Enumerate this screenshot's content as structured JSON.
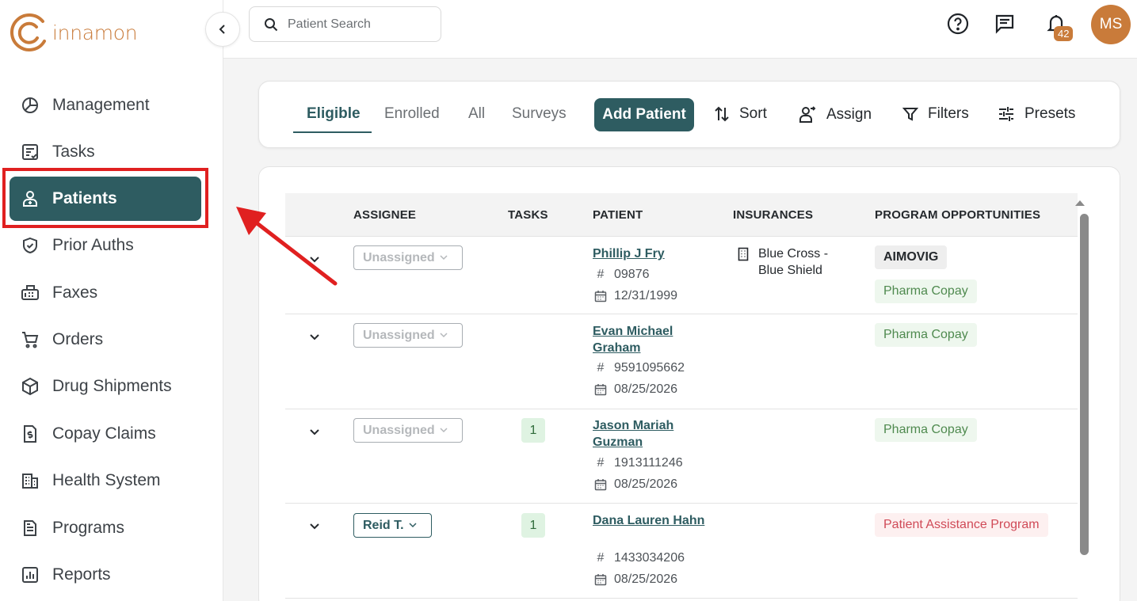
{
  "brand": {
    "name": "innamon"
  },
  "sidebar": {
    "items": [
      {
        "label": "Management",
        "icon": "management-icon"
      },
      {
        "label": "Tasks",
        "icon": "tasks-icon"
      },
      {
        "label": "Patients",
        "icon": "patients-icon",
        "active": true
      },
      {
        "label": "Prior Auths",
        "icon": "shield-icon"
      },
      {
        "label": "Faxes",
        "icon": "fax-icon"
      },
      {
        "label": "Orders",
        "icon": "cart-icon"
      },
      {
        "label": "Drug Shipments",
        "icon": "package-icon"
      },
      {
        "label": "Copay Claims",
        "icon": "dollar-document-icon"
      },
      {
        "label": "Health System",
        "icon": "building-icon"
      },
      {
        "label": "Programs",
        "icon": "document-icon"
      },
      {
        "label": "Reports",
        "icon": "report-icon"
      }
    ]
  },
  "topbar": {
    "search_placeholder": "Patient Search",
    "notification_count": "42",
    "avatar_initials": "MS"
  },
  "toolbar": {
    "tabs": [
      "Eligible",
      "Enrolled",
      "All",
      "Surveys"
    ],
    "active_tab": "Eligible",
    "add_patient": "Add Patient",
    "sort": "Sort",
    "assign": "Assign",
    "filters": "Filters",
    "presets": "Presets"
  },
  "table": {
    "headers": [
      "ASSIGNEE",
      "TASKS",
      "PATIENT",
      "INSURANCES",
      "PROGRAM OPPORTUNITIES"
    ],
    "rows": [
      {
        "assignee": "Unassigned",
        "tasks": "",
        "patient_name": "Phillip J Fry",
        "patient_id": "09876",
        "dob": "12/31/1999",
        "insurance": "Blue Cross - Blue Shield",
        "programs": [
          "AIMOVIG",
          "Pharma Copay"
        ]
      },
      {
        "assignee": "Unassigned",
        "tasks": "",
        "patient_name": "Evan Michael Graham",
        "patient_id": "9591095662",
        "dob": "08/25/2026",
        "insurance": "",
        "programs": [
          "Pharma Copay"
        ]
      },
      {
        "assignee": "Unassigned",
        "tasks": "1",
        "patient_name": "Jason Mariah Guzman",
        "patient_id": "1913111246",
        "dob": "08/25/2026",
        "insurance": "",
        "programs": [
          "Pharma Copay"
        ]
      },
      {
        "assignee": "Reid T.",
        "tasks": "1",
        "patient_name": "Dana Lauren Hahn",
        "patient_id": "1433034206",
        "dob": "08/25/2026",
        "insurance": "",
        "programs": [
          "Patient Assistance Program"
        ]
      }
    ]
  },
  "colors": {
    "primary": "#2e5c61",
    "brand": "#c97b3a",
    "highlight": "#e02020"
  }
}
